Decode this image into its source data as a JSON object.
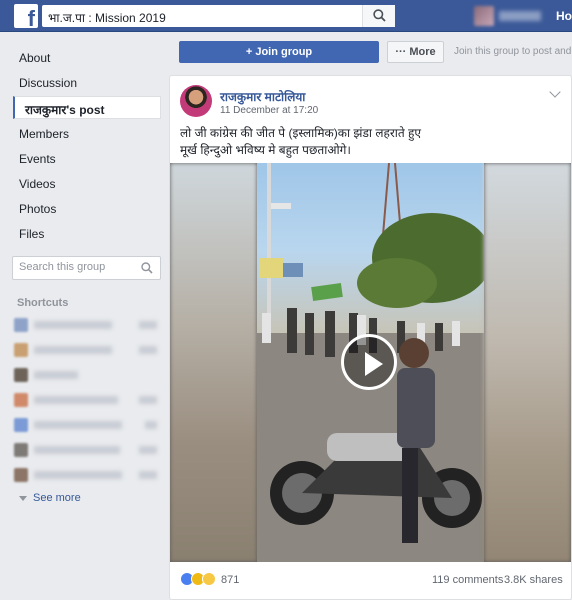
{
  "topbar": {
    "search_query": "भा.ज.पा : Mission 2019",
    "home_label": "Home"
  },
  "leftnav": {
    "items": [
      "About",
      "Discussion",
      "राजकुमार's post",
      "Members",
      "Events",
      "Videos",
      "Photos",
      "Files"
    ],
    "active_index": 2,
    "search_placeholder": "Search this group",
    "shortcuts_title": "Shortcuts",
    "see_more_label": "See more"
  },
  "group_actions": {
    "join_label": "+ Join group",
    "more_label": "··· More",
    "join_hint": "Join this group to post and c"
  },
  "post": {
    "author": "राजकुमार माटोलिया",
    "timestamp": "11 December at 17:20",
    "text_line1": "लो जी कांग्रेस की जीत पे (इस्लामिक)का झंडा लहराते हुए",
    "text_line2": "मूर्ख हिन्दुओ भविष्य मे बहुत पछताओगे।",
    "reaction_count": "871",
    "comments": "119 comments",
    "shares": "3.8K shares"
  },
  "colors": {
    "brand_blue": "#3b5998",
    "button_blue": "#4267b2",
    "link_blue": "#365899",
    "page_bg": "#e9ebee"
  }
}
